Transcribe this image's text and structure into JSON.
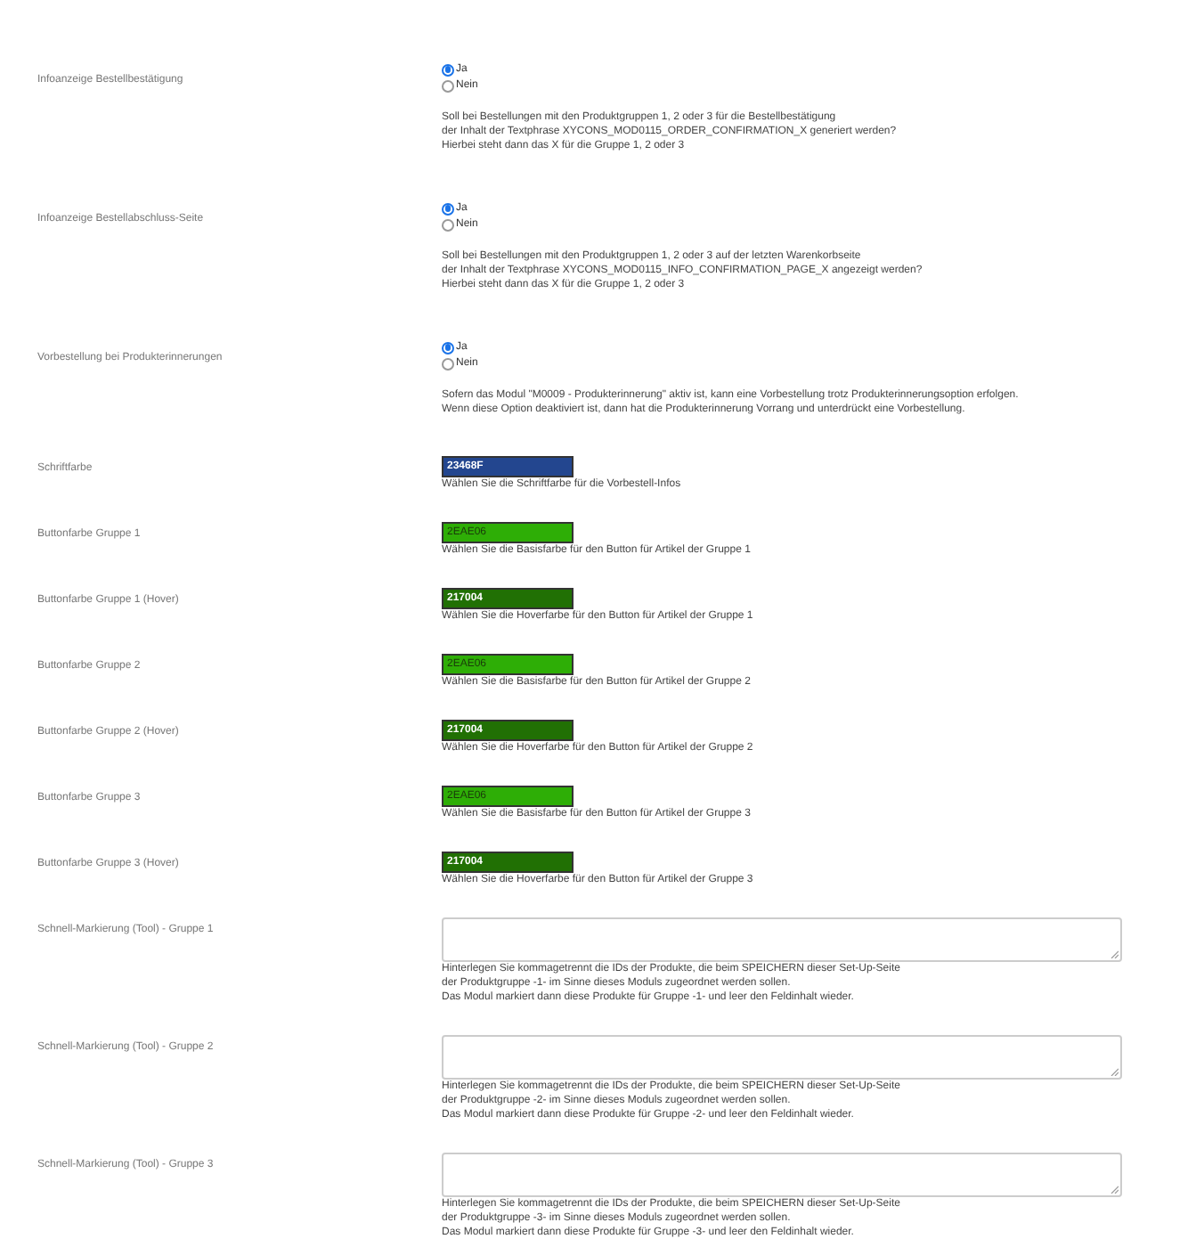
{
  "settings": [
    {
      "kind": "radio",
      "label": "Infoanzeige Bestellbestätigung",
      "options": [
        {
          "label": "Ja",
          "selected": true
        },
        {
          "label": "Nein",
          "selected": false
        }
      ],
      "description": [
        "Soll bei Bestellungen mit den Produktgruppen 1, 2 oder 3 für die Bestellbestätigung",
        "der Inhalt der Textphrase XYCONS_MOD0115_ORDER_CONFIRMATION_X generiert werden?",
        "Hierbei steht dann das X für die Gruppe 1, 2 oder 3"
      ]
    },
    {
      "kind": "radio",
      "label": "Infoanzeige Bestellabschluss-Seite",
      "options": [
        {
          "label": "Ja",
          "selected": true
        },
        {
          "label": "Nein",
          "selected": false
        }
      ],
      "description": [
        "Soll bei Bestellungen mit den Produktgruppen 1, 2 oder 3 auf der letzten Warenkorbseite",
        "der Inhalt der Textphrase XYCONS_MOD0115_INFO_CONFIRMATION_PAGE_X angezeigt werden?",
        "Hierbei steht dann das X für die Gruppe 1, 2 oder 3"
      ]
    },
    {
      "kind": "radio",
      "label": "Vorbestellung bei Produkterinnerungen",
      "options": [
        {
          "label": "Ja",
          "selected": true
        },
        {
          "label": "Nein",
          "selected": false
        }
      ],
      "description": [
        "Sofern das Modul \"M0009 - Produkterinnerung\" aktiv ist, kann eine Vorbestellung trotz Produkterinnerungsoption erfolgen.",
        "Wenn diese Option deaktiviert ist, dann hat die Produkterinnerung Vorrang und unterdrückt eine Vorbestellung."
      ]
    },
    {
      "kind": "color",
      "label": "Schriftfarbe",
      "value": "23468F",
      "color": "#23468f",
      "description": [
        "Wählen Sie die Schriftfarbe für die Vorbestell-Infos"
      ]
    },
    {
      "kind": "color",
      "label": "Buttonfarbe Gruppe 1",
      "value": "2EAE06",
      "color": "#2eae06",
      "description": [
        "Wählen Sie die Basisfarbe für den Button für Artikel der Gruppe 1"
      ]
    },
    {
      "kind": "color",
      "label": "Buttonfarbe Gruppe 1 (Hover)",
      "value": "217004",
      "color": "#217004",
      "description": [
        "Wählen Sie die Hoverfarbe für den Button für Artikel der Gruppe 1"
      ]
    },
    {
      "kind": "color",
      "label": "Buttonfarbe Gruppe 2",
      "value": "2EAE06",
      "color": "#2eae06",
      "description": [
        "Wählen Sie die Basisfarbe für den Button für Artikel der Gruppe 2"
      ]
    },
    {
      "kind": "color",
      "label": "Buttonfarbe Gruppe 2 (Hover)",
      "value": "217004",
      "color": "#217004",
      "description": [
        "Wählen Sie die Hoverfarbe für den Button für Artikel der Gruppe 2"
      ]
    },
    {
      "kind": "color",
      "label": "Buttonfarbe Gruppe 3",
      "value": "2EAE06",
      "color": "#2eae06",
      "description": [
        "Wählen Sie die Basisfarbe für den Button für Artikel der Gruppe 3"
      ]
    },
    {
      "kind": "color",
      "label": "Buttonfarbe Gruppe 3 (Hover)",
      "value": "217004",
      "color": "#217004",
      "description": [
        "Wählen Sie die Hoverfarbe für den Button für Artikel der Gruppe 3"
      ]
    },
    {
      "kind": "textarea",
      "label": "Schnell-Markierung (Tool) - Gruppe 1",
      "description": [
        "Hinterlegen Sie kommagetrennt die IDs der Produkte, die beim SPEICHERN dieser Set-Up-Seite",
        "der Produktgruppe -1- im Sinne dieses Moduls zugeordnet werden sollen.",
        "Das Modul markiert dann diese Produkte für Gruppe -1- und leer den Feldinhalt wieder."
      ]
    },
    {
      "kind": "textarea",
      "label": "Schnell-Markierung (Tool) - Gruppe 2",
      "description": [
        "Hinterlegen Sie kommagetrennt die IDs der Produkte, die beim SPEICHERN dieser Set-Up-Seite",
        "der Produktgruppe -2- im Sinne dieses Moduls zugeordnet werden sollen.",
        "Das Modul markiert dann diese Produkte für Gruppe -2- und leer den Feldinhalt wieder."
      ]
    },
    {
      "kind": "textarea",
      "label": "Schnell-Markierung (Tool) - Gruppe 3",
      "description": [
        "Hinterlegen Sie kommagetrennt die IDs der Produkte, die beim SPEICHERN dieser Set-Up-Seite",
        "der Produktgruppe -3- im Sinne dieses Moduls zugeordnet werden sollen.",
        "Das Modul markiert dann diese Produkte für Gruppe -3- und leer den Feldinhalt wieder."
      ]
    }
  ]
}
